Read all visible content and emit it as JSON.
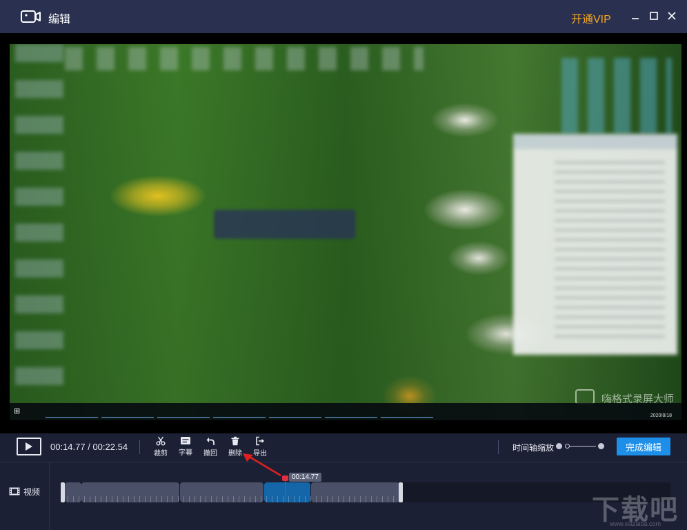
{
  "titlebar": {
    "title": "编辑",
    "vip_label": "开通VIP"
  },
  "preview": {
    "watermark_text": "嗨格式录屏大师",
    "tray_date": "2020/8/18"
  },
  "controls": {
    "time_display": "00:14.77 / 00:22.54",
    "tools": [
      {
        "label": "裁剪",
        "icon": "scissors-icon"
      },
      {
        "label": "字幕",
        "icon": "subtitle-icon"
      },
      {
        "label": "撤回",
        "icon": "undo-icon"
      },
      {
        "label": "删除",
        "icon": "trash-icon"
      },
      {
        "label": "导出",
        "icon": "export-icon"
      }
    ],
    "zoom_label": "时间轴缩放",
    "finish_label": "完成编辑"
  },
  "timeline": {
    "track_label": "视频",
    "playhead_time": "00:14.77"
  },
  "site_watermark": {
    "big": "下载吧",
    "small": "www.xiazaiba.com"
  },
  "colors": {
    "accent": "#1e8fe8",
    "vip": "#f5a623",
    "playhead": "#e03040",
    "selected_clip": "#1466a8"
  }
}
